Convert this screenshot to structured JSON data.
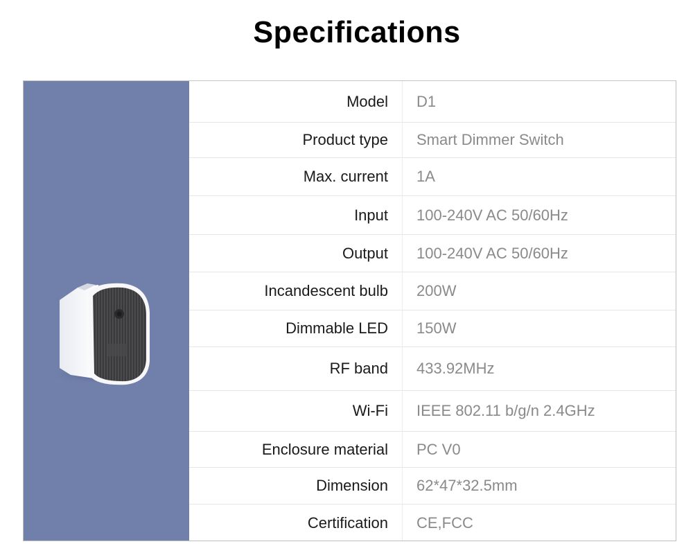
{
  "page": {
    "title": "Specifications"
  },
  "product_image": {
    "alt": "Smart dimmer switch module",
    "side_panel_color": "#717fab"
  },
  "specs": [
    {
      "label": "Model",
      "value": "D1"
    },
    {
      "label": "Product type",
      "value": "Smart Dimmer Switch"
    },
    {
      "label": "Max. current",
      "value": "1A"
    },
    {
      "label": "Input",
      "value": "100-240V AC 50/60Hz"
    },
    {
      "label": "Output",
      "value": "100-240V AC 50/60Hz"
    },
    {
      "label": "Incandescent bulb",
      "value": "200W"
    },
    {
      "label": "Dimmable LED",
      "value": "150W"
    },
    {
      "label": "RF band",
      "value": "433.92MHz"
    },
    {
      "label": "Wi-Fi",
      "value": "IEEE 802.11 b/g/n 2.4GHz"
    },
    {
      "label": "Enclosure material",
      "value": "PC V0"
    },
    {
      "label": "Dimension",
      "value": "62*47*32.5mm"
    },
    {
      "label": "Certification",
      "value": "CE,FCC"
    }
  ]
}
